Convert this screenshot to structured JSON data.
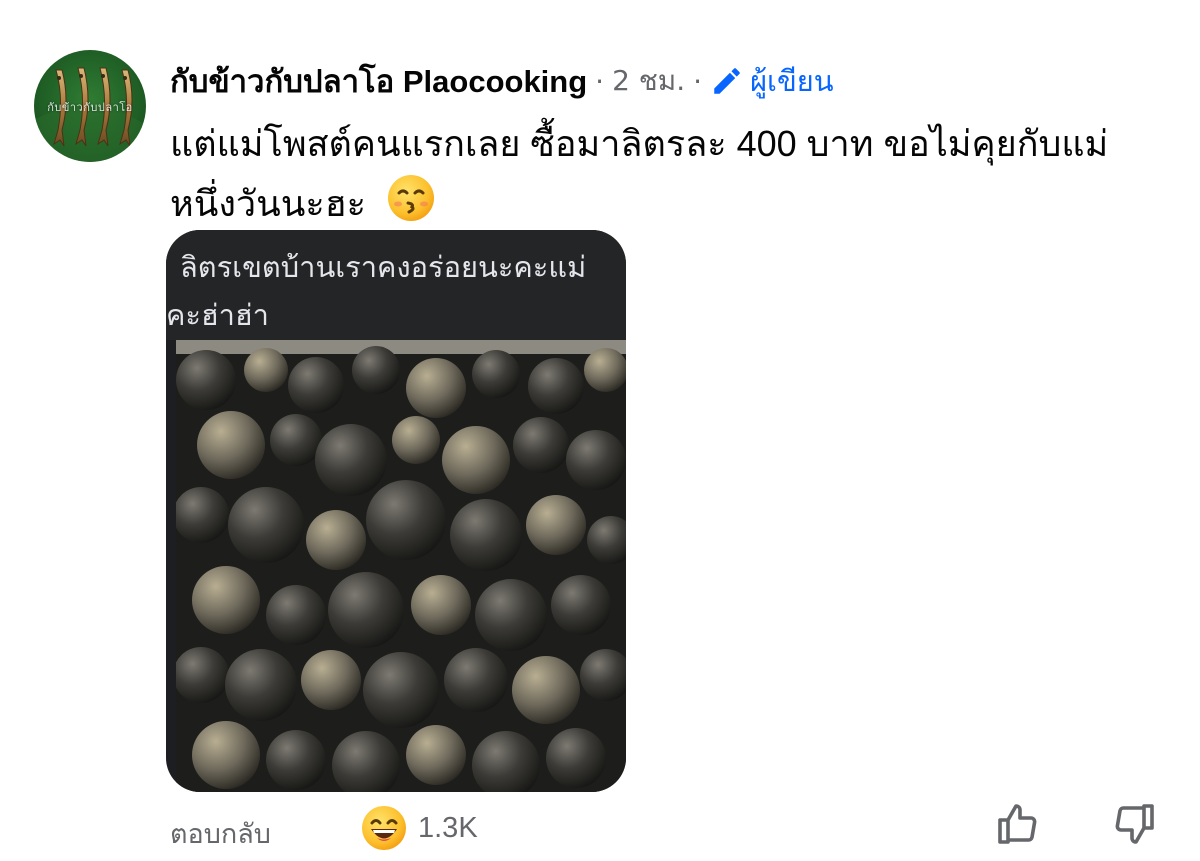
{
  "comment": {
    "author": "กับข้าวกับปลาโอ Plaocooking",
    "separator": "·",
    "time": "2 ชม.",
    "author_badge": "ผู้เขียน",
    "text": "แต่แม่โพสต์คนแรกเลย ซื้อมาลิตรละ 400 บาท  ขอไม่คุยกับแม่หนึ่งวันนะฮะ",
    "emoji": "kissing-face-emoji"
  },
  "avatar": {
    "caption": "กับข้าวกับปลาโอ"
  },
  "attachment": {
    "caption_line1": "ลิตรเขตบ้านเราคงอร่อยนะคะแม่",
    "caption_line2": "คะฮ่าฮ่า"
  },
  "footer": {
    "reply_label": "ตอบกลับ",
    "reaction_emoji": "grinning-face-emoji",
    "reaction_count": "1.3K",
    "like_icon": "thumbs-up-icon",
    "dislike_icon": "thumbs-down-icon"
  },
  "colors": {
    "text_primary": "#050505",
    "text_secondary": "#65676b",
    "accent_blue": "#0866ff",
    "attachment_dark": "#242526"
  }
}
